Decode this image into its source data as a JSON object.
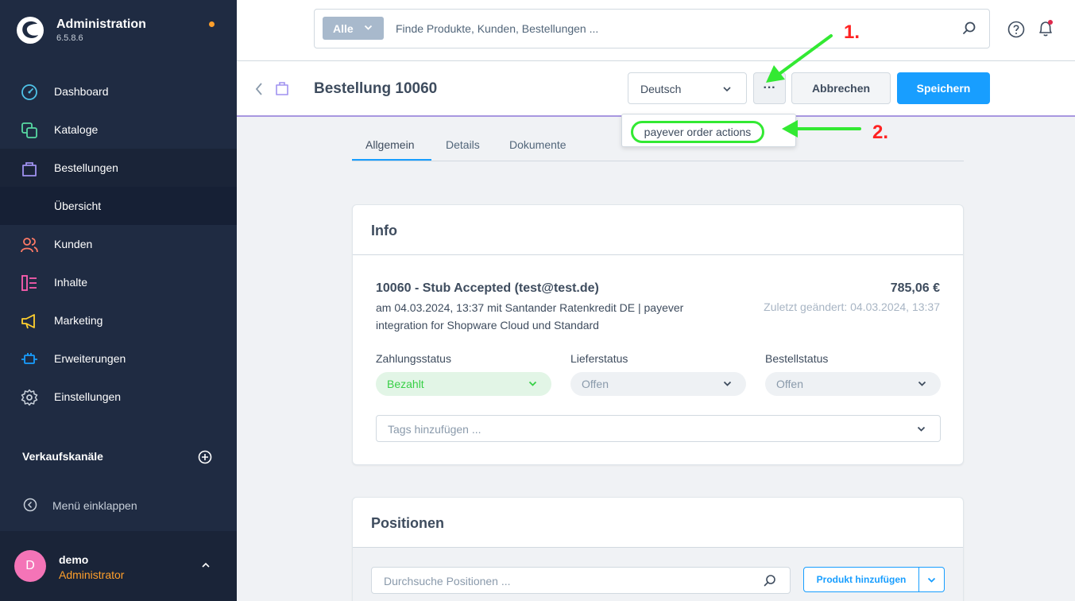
{
  "app": {
    "title": "Administration",
    "version": "6.5.8.6"
  },
  "colors": {
    "sidebar": "#1f2b42",
    "accent": "#189eff",
    "notification_dot": "#ff9f2b",
    "highlight_green": "#33e933",
    "annotation_red": "#ff2222"
  },
  "sidebar": {
    "items": [
      {
        "label": "Dashboard",
        "icon": "gauge-icon"
      },
      {
        "label": "Kataloge",
        "icon": "catalog-icon"
      },
      {
        "label": "Bestellungen",
        "icon": "shopping-bag-icon"
      },
      {
        "label": "Übersicht",
        "icon": ""
      },
      {
        "label": "Kunden",
        "icon": "users-icon"
      },
      {
        "label": "Inhalte",
        "icon": "content-icon"
      },
      {
        "label": "Marketing",
        "icon": "megaphone-icon"
      },
      {
        "label": "Erweiterungen",
        "icon": "plug-icon"
      },
      {
        "label": "Einstellungen",
        "icon": "gear-icon"
      }
    ],
    "sales_channels_label": "Verkaufskanäle",
    "collapse_label": "Menü einklappen",
    "user": {
      "initial": "D",
      "name": "demo",
      "role": "Administrator"
    }
  },
  "search": {
    "type_label": "Alle",
    "placeholder": "Finde Produkte, Kunden, Bestellungen ..."
  },
  "smartbar": {
    "title": "Bestellung 10060",
    "language": "Deutsch",
    "more_label": "···",
    "cancel_label": "Abbrechen",
    "save_label": "Speichern"
  },
  "context_menu": {
    "items": [
      "payever order actions"
    ]
  },
  "annotations": {
    "step1": "1.",
    "step2": "2."
  },
  "tabs": [
    {
      "label": "Allgemein",
      "active": true
    },
    {
      "label": "Details",
      "active": false
    },
    {
      "label": "Dokumente",
      "active": false
    }
  ],
  "info_card": {
    "title": "Info",
    "order_heading": "10060 - Stub Accepted (test@test.de)",
    "order_description": "am 04.03.2024, 13:37 mit Santander Ratenkredit DE | payever integration for Shopware Cloud und Standard",
    "total": "785,06 €",
    "last_changed": "Zuletzt geändert: 04.03.2024, 13:37",
    "payment_status_label": "Zahlungsstatus",
    "payment_status": "Bezahlt",
    "delivery_status_label": "Lieferstatus",
    "delivery_status": "Offen",
    "order_status_label": "Bestellstatus",
    "order_status": "Offen",
    "tags_placeholder": "Tags hinzufügen ..."
  },
  "positions_card": {
    "title": "Positionen",
    "search_placeholder": "Durchsuche Positionen ...",
    "add_label": "Produkt hinzufügen"
  }
}
